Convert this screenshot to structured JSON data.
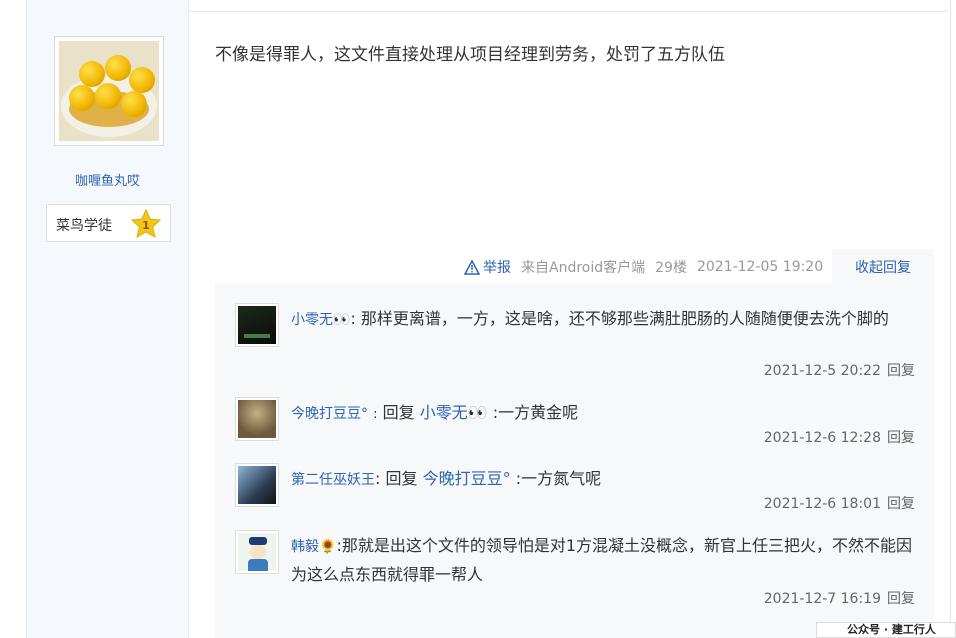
{
  "post": {
    "author": "咖喱鱼丸哎",
    "rank_label": "菜鸟学徒",
    "rank_level": "1",
    "content": "不像是得罪人，这文件直接处理从项目经理到劳务，处罚了五方队伍",
    "report_label": "举报",
    "source": "来自Android客户端",
    "floor": "29楼",
    "datetime": "2021-12-05 19:20",
    "collapse_label": "收起回复"
  },
  "replies": [
    {
      "name": "小零无👀",
      "separator": ":",
      "text": "那样更离谱，一方，这是啥，还不够那些满肚肥肠的人随随便便去洗个脚的",
      "time": "2021-12-5 20:22",
      "reply_label": "回复"
    },
    {
      "name": "今晚打豆豆°",
      "separator": ":",
      "reply_prefix": "回复",
      "reply_to": "小零无👀",
      "text": ":一方黄金呢",
      "time": "2021-12-6 12:28",
      "reply_label": "回复"
    },
    {
      "name": "第二任巫妖王",
      "separator": ":",
      "reply_prefix": "回复",
      "reply_to": "今晚打豆豆°",
      "text": ":一方氮气呢",
      "time": "2021-12-6 18:01",
      "reply_label": "回复"
    },
    {
      "name": "韩毅🌻",
      "separator": ":",
      "text": "那就是出这个文件的领导怕是对1方混凝土没概念，新官上任三把火，不然不能因为这么点东西就得罪一帮人",
      "time": "2021-12-7 16:19",
      "reply_label": "回复"
    }
  ],
  "watermark": "公众号 · 建工行人",
  "colors": {
    "link": "#2d64b3",
    "sidebar": "#f5f8fd",
    "reply_bg": "#f7f8fa",
    "star": "#f5c518"
  }
}
